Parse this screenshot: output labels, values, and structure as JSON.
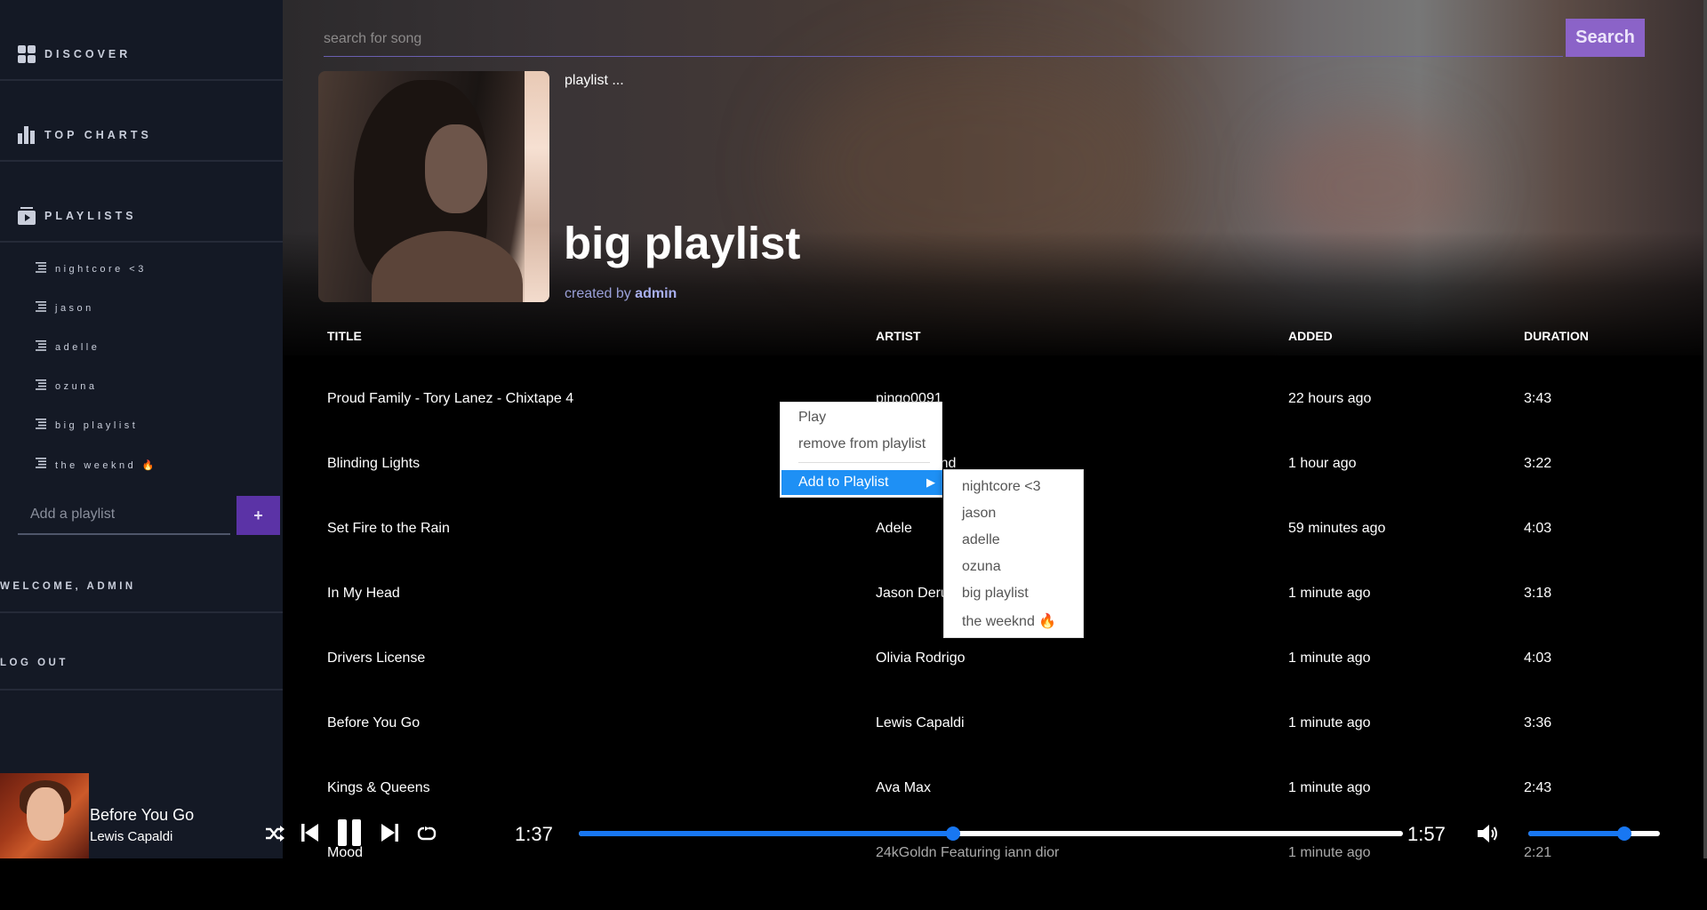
{
  "sidebar": {
    "nav": [
      {
        "label": "DISCOVER",
        "icon": "grid-icon"
      },
      {
        "label": "TOP CHARTS",
        "icon": "bar-chart-icon"
      },
      {
        "label": "PLAYLISTS",
        "icon": "playlist-icon"
      }
    ],
    "playlists": [
      {
        "label": "nightcore <3"
      },
      {
        "label": "jason"
      },
      {
        "label": "adelle"
      },
      {
        "label": "ozuna"
      },
      {
        "label": "big playlist"
      },
      {
        "label": "the weeknd 🔥"
      }
    ],
    "add_playlist_placeholder": "Add a playlist",
    "add_playlist_button": "+",
    "welcome": "WELCOME, ADMIN",
    "logout": "LOG OUT"
  },
  "search": {
    "placeholder": "search for song",
    "button": "Search"
  },
  "playlist": {
    "type_label": "playlist ...",
    "title": "big playlist",
    "created_by_prefix": "created by",
    "creator": "admin"
  },
  "table": {
    "headers": [
      "TITLE",
      "ARTIST",
      "ADDED",
      "DURATION"
    ],
    "rows": [
      {
        "title": "Proud Family - Tory Lanez - Chixtape 4",
        "artist": "pingo0091",
        "added": "22 hours ago",
        "duration": "3:43"
      },
      {
        "title": "Blinding Lights",
        "artist": "The Weeknd",
        "added": "1 hour ago",
        "duration": "3:22"
      },
      {
        "title": "Set Fire to the Rain",
        "artist": "Adele",
        "added": "59 minutes ago",
        "duration": "4:03"
      },
      {
        "title": "In My Head",
        "artist": "Jason Derulo",
        "added": "1 minute ago",
        "duration": "3:18"
      },
      {
        "title": "Drivers License",
        "artist": "Olivia Rodrigo",
        "added": "1 minute ago",
        "duration": "4:03"
      },
      {
        "title": "Before You Go",
        "artist": "Lewis Capaldi",
        "added": "1 minute ago",
        "duration": "3:36"
      },
      {
        "title": "Kings & Queens",
        "artist": "Ava Max",
        "added": "1 minute ago",
        "duration": "2:43"
      },
      {
        "title": "Mood",
        "artist": "24kGoldn Featuring iann dior",
        "added": "1 minute ago",
        "duration": "2:21"
      }
    ]
  },
  "context_menu": {
    "items": [
      "Play",
      "remove from playlist"
    ],
    "submenu_label": "Add to Playlist",
    "submenu_arrow": "▶",
    "submenu_items": [
      "nightcore <3",
      "jason",
      "adelle",
      "ozuna",
      "big playlist",
      "the weeknd 🔥"
    ]
  },
  "player": {
    "title": "Before You Go",
    "artist": "Lewis Capaldi",
    "elapsed": "1:37",
    "total": "1:57",
    "progress": 0.454,
    "volume": 0.73,
    "accent": "#1877f2"
  }
}
